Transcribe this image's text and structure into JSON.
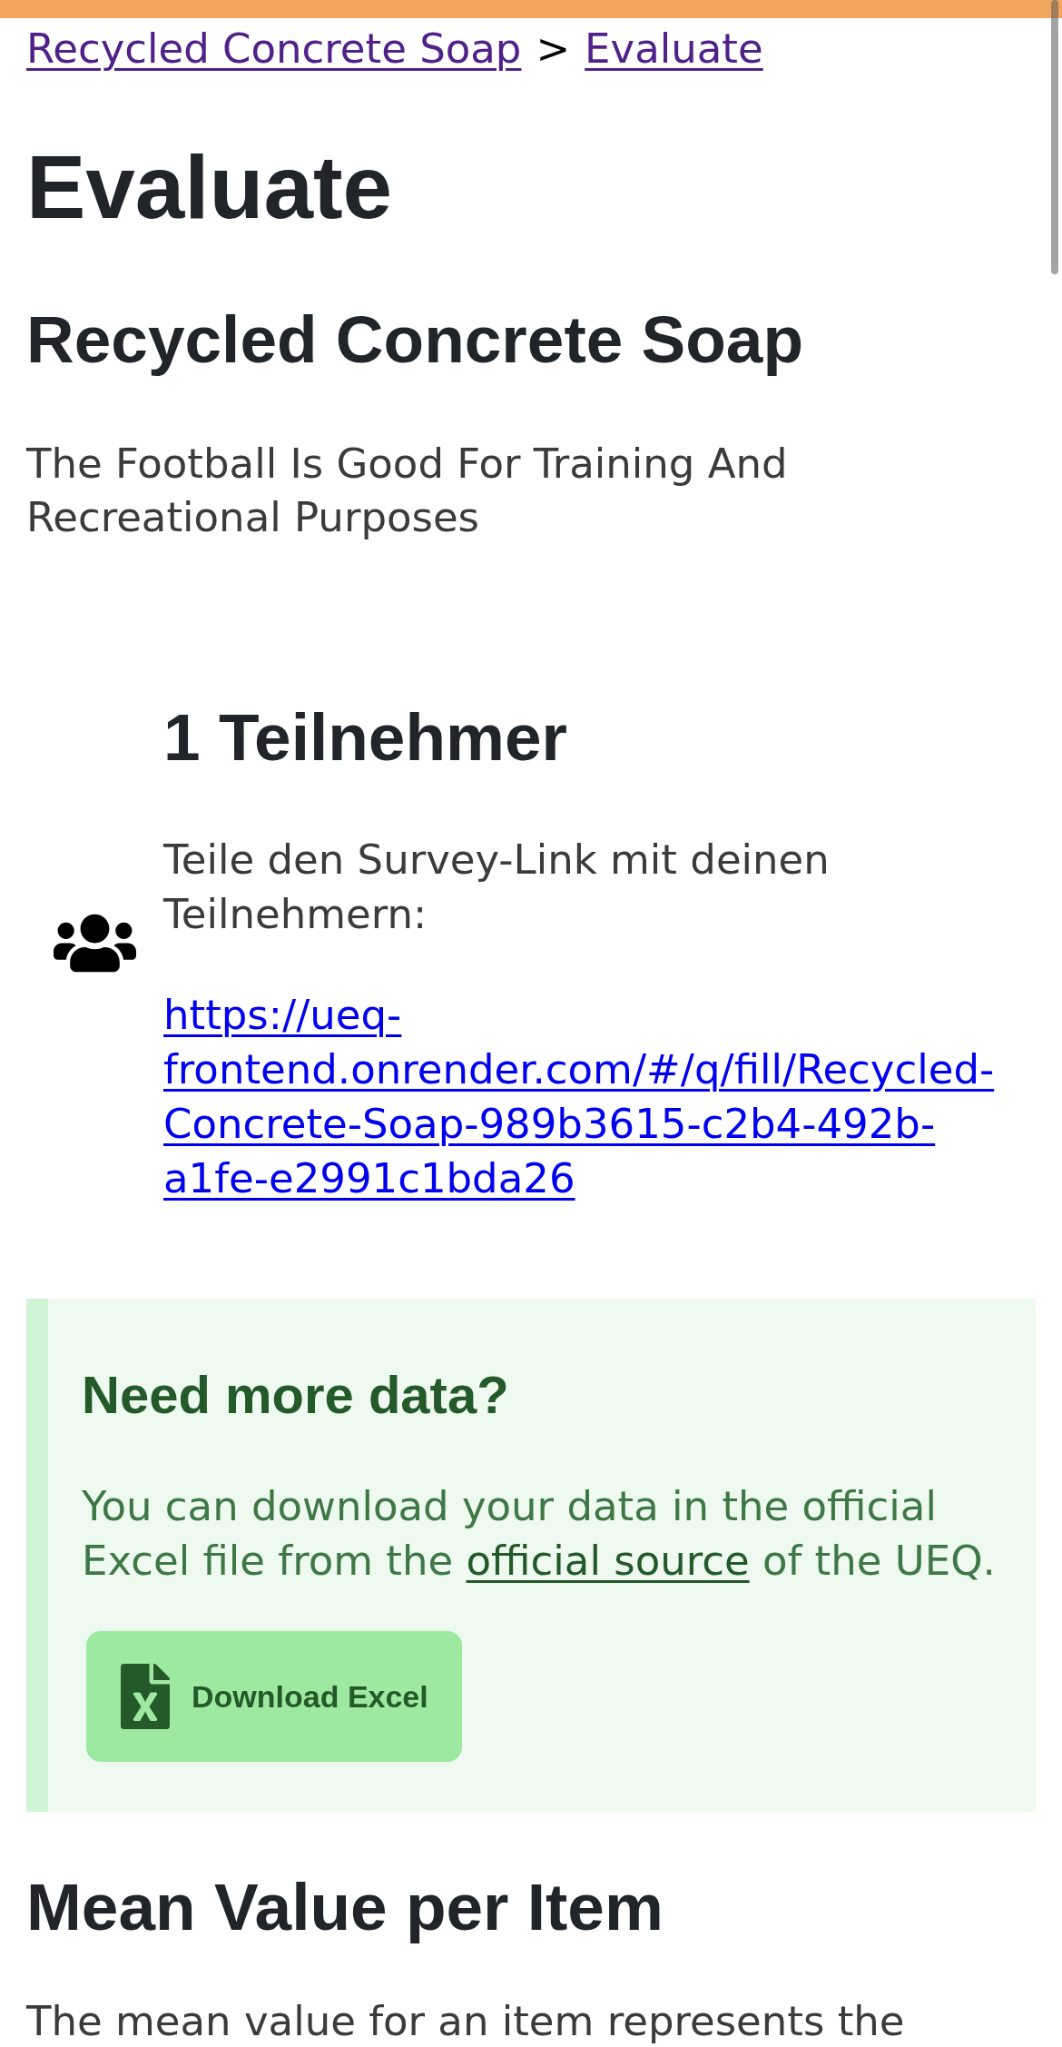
{
  "breadcrumb": {
    "items": [
      {
        "label": "Recycled Concrete Soap"
      },
      {
        "label": "Evaluate"
      }
    ],
    "separator": ">"
  },
  "title": "Evaluate",
  "product": {
    "name": "Recycled Concrete Soap",
    "description": "The Football Is Good For Training And Recreational Purposes"
  },
  "participants": {
    "heading": "1 Teilnehmer",
    "share_text": "Teile den Survey-Link mit deinen Teilnehmern:",
    "survey_link": "https://ueq-frontend.onrender.com/#/q/fill/Recycled-Concrete-Soap-989b3615-c2b4-492b-a1fe-e2991c1bda26"
  },
  "more_data_callout": {
    "heading": "Need more data?",
    "text_before": "You can download your data in the official Excel file from the ",
    "link": "official source",
    "text_after": " of the UEQ.",
    "button": "Download Excel"
  },
  "mean_value_section": {
    "heading": "Mean Value per Item",
    "text": "The mean value for an item represents the"
  }
}
